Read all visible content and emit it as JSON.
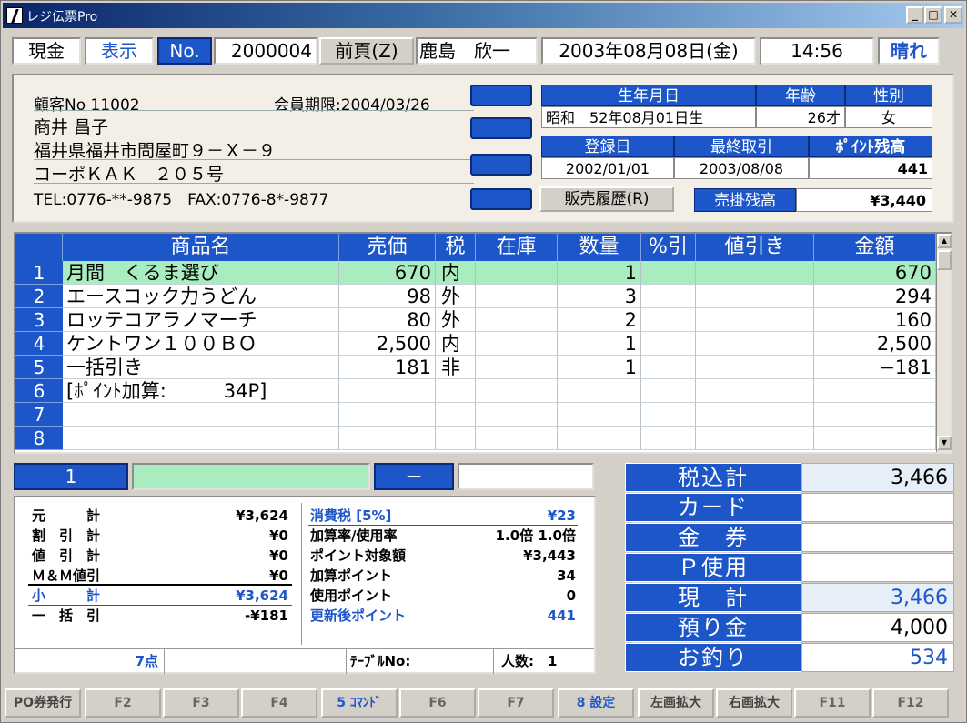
{
  "window": {
    "title": "レジ伝票Pro"
  },
  "topbar": {
    "payment_type": "現金",
    "mode": "表示",
    "no_label": "No.",
    "slip_no": "2000004",
    "prev_page": "前頁(Z)",
    "staff": "鹿島　欣一",
    "date": "2003年08月08日(金)",
    "time": "14:56",
    "weather": "晴れ"
  },
  "customer": {
    "customer_no": "顧客No 11002",
    "member_expiry": "会員期限:2004/03/26",
    "name": "商井 昌子",
    "address1": "福井県福井市問屋町９－Ｘ－９",
    "address2": "コーポＫＡＫ　２０５号",
    "phone": "TEL:0776-**-9875　FAX:0776-8*-9877"
  },
  "info": {
    "birth_h": "生年月日",
    "age_h": "年齢",
    "sex_h": "性別",
    "birth_era": "昭和",
    "birth_date": "52年08月01日生",
    "age": "26才",
    "sex": "女",
    "reg_h": "登録日",
    "last_h": "最終取引",
    "point_h": "ﾎﾟｲﾝﾄ残高",
    "reg": "2002/01/01",
    "last": "2003/08/08",
    "points": "441",
    "history_btn": "販売履歴(R)",
    "credit_h": "売掛残高",
    "credit": "¥3,440"
  },
  "grid": {
    "headers": [
      "商品名",
      "売価",
      "税",
      "在庫",
      "数量",
      "%引",
      "値引き",
      "金額"
    ],
    "rows": [
      {
        "no": "1",
        "name": "月間　くるま選び",
        "price": "670",
        "tax": "内",
        "stock": "",
        "qty": "1",
        "pct": "",
        "disc": "",
        "amount": "670"
      },
      {
        "no": "2",
        "name": "エースコック力うどん",
        "price": "98",
        "tax": "外",
        "stock": "",
        "qty": "3",
        "pct": "",
        "disc": "",
        "amount": "294"
      },
      {
        "no": "3",
        "name": "ロッテコアラノマーチ",
        "price": "80",
        "tax": "外",
        "stock": "",
        "qty": "2",
        "pct": "",
        "disc": "",
        "amount": "160"
      },
      {
        "no": "4",
        "name": "ケントワン１００ＢＯ",
        "price": "2,500",
        "tax": "内",
        "stock": "",
        "qty": "1",
        "pct": "",
        "disc": "",
        "amount": "2,500"
      },
      {
        "no": "5",
        "name": "一括引き",
        "price": "181",
        "tax": "非",
        "stock": "",
        "qty": "1",
        "pct": "",
        "disc": "",
        "amount": "−181"
      },
      {
        "no": "6",
        "name": "[ﾎﾟｲﾝﾄ加算:　　　34P]",
        "price": "",
        "tax": "",
        "stock": "",
        "qty": "",
        "pct": "",
        "disc": "",
        "amount": ""
      },
      {
        "no": "7",
        "name": "",
        "price": "",
        "tax": "",
        "stock": "",
        "qty": "",
        "pct": "",
        "disc": "",
        "amount": ""
      },
      {
        "no": "8",
        "name": "",
        "price": "",
        "tax": "",
        "stock": "",
        "qty": "",
        "pct": "",
        "disc": "",
        "amount": ""
      }
    ]
  },
  "input_bar": {
    "line": "1",
    "code": "",
    "sign": "－",
    "value": ""
  },
  "summary": {
    "left": [
      {
        "label": "元　　　計",
        "value": "¥3,624"
      },
      {
        "label": "割　引　計",
        "value": "¥0"
      },
      {
        "label": "値　引　計",
        "value": "¥0"
      },
      {
        "label": "Ｍ＆Ｍ値引",
        "value": "¥0"
      },
      {
        "label": "小　　　計",
        "value": "¥3,624"
      },
      {
        "label": "一　括　引",
        "value": "-¥181"
      }
    ],
    "right": [
      {
        "label": "消費税 [5%]",
        "value": "¥23"
      },
      {
        "label": "加算率/使用率",
        "value": "1.0倍 1.0倍"
      },
      {
        "label": "ポイント対象額",
        "value": "¥3,443"
      },
      {
        "label": "加算ポイント",
        "value": "34"
      },
      {
        "label": "使用ポイント",
        "value": "0"
      },
      {
        "label": "更新後ポイント",
        "value": "441"
      }
    ],
    "count": "7点",
    "table_no_label": "ﾃｰﾌﾞﾙNo:",
    "people_label": "人数:",
    "people": "1"
  },
  "totals": [
    {
      "label": "税込計",
      "value": "3,466"
    },
    {
      "label": "カード",
      "value": ""
    },
    {
      "label": "金　券",
      "value": ""
    },
    {
      "label": "Ｐ使用",
      "value": ""
    },
    {
      "label": "現　計",
      "value": "3,466"
    },
    {
      "label": "預り金",
      "value": "4,000"
    },
    {
      "label": "お釣り",
      "value": "534"
    }
  ],
  "fkeys": [
    "PO券発行",
    "F2",
    "F3",
    "F4",
    "5 ｺﾏﾝﾄﾞ",
    "F6",
    "F7",
    "8 設定",
    "左画拡大",
    "右画拡大",
    "F11",
    "F12"
  ],
  "colors": {
    "header_blue": "#1c56c8",
    "highlight_row": "#a8ecc0",
    "panel_beige": "#f3eee6"
  }
}
